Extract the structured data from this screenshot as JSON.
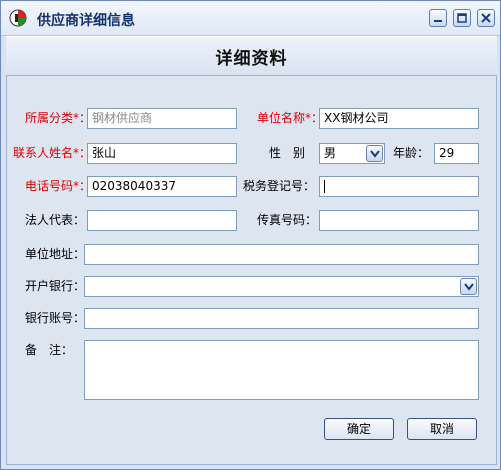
{
  "window": {
    "title": "供应商详细信息"
  },
  "header": {
    "title": "详细资料"
  },
  "form": {
    "category_label": "所属分类",
    "category_value": "钢材供应商",
    "unit_name_label": "单位名称",
    "unit_name_value": "XX钢材公司",
    "contact_label": "联系人姓名",
    "contact_value": "张山",
    "gender_label": "性　别",
    "gender_value": "男",
    "age_label": "年龄：",
    "age_value": "29",
    "phone_label": "电话号码",
    "phone_value": "02038040337",
    "tax_label": "税务登记号：",
    "tax_value": "",
    "legal_label": "法人代表：",
    "legal_value": "",
    "fax_label": "传真号码：",
    "fax_value": "",
    "address_label": "单位地址：",
    "address_value": "",
    "bank_label": "开户银行：",
    "bank_value": "",
    "account_label": "银行账号：",
    "account_value": "",
    "remark_label": "备　注：",
    "remark_value": "",
    "required_mark": "*：",
    "required_color": "#e00000"
  },
  "buttons": {
    "ok": "确定",
    "cancel": "取消"
  }
}
